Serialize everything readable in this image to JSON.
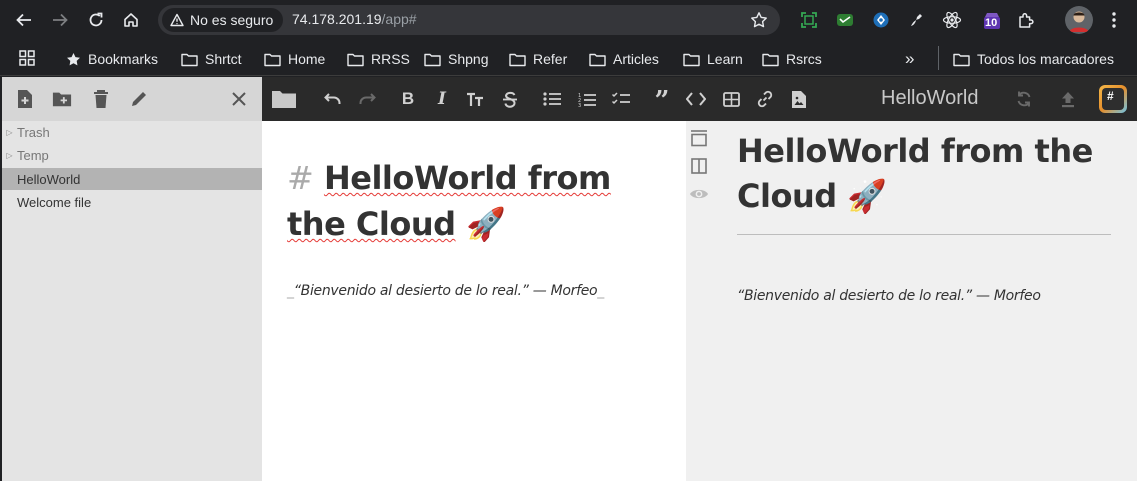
{
  "browser": {
    "security_label": "No es seguro",
    "url_host": "74.178.201.19",
    "url_path": "/app#",
    "extension_badge": "10",
    "bookmarks": [
      {
        "label": "Bookmarks",
        "icon": "star-icon"
      },
      {
        "label": "Shrtct",
        "icon": "folder-icon"
      },
      {
        "label": "Home",
        "icon": "folder-icon"
      },
      {
        "label": "RRSS",
        "icon": "folder-icon"
      },
      {
        "label": "Shpng",
        "icon": "folder-icon"
      },
      {
        "label": "Refer",
        "icon": "folder-icon"
      },
      {
        "label": "Articles",
        "icon": "folder-icon"
      },
      {
        "label": "Learn",
        "icon": "folder-icon"
      },
      {
        "label": "Rsrcs",
        "icon": "folder-icon"
      }
    ],
    "overflow_label": "»",
    "all_bookmarks_label": "Todos los marcadores"
  },
  "sidebar": {
    "items": [
      {
        "label": "Trash",
        "type": "folder"
      },
      {
        "label": "Temp",
        "type": "folder"
      },
      {
        "label": "HelloWorld",
        "type": "file",
        "active": true
      },
      {
        "label": "Welcome file",
        "type": "file"
      }
    ]
  },
  "toolbar": {
    "document_name": "HelloWorld",
    "badge_label": "#"
  },
  "editor": {
    "heading_marker": "#",
    "heading_text": "HelloWorld from the Cloud",
    "heading_emoji": "🚀",
    "quote_marker": "_",
    "quote_text": "“Bienvenido al desierto de lo real.” — Morfeo",
    "quote_marker_end": "_"
  },
  "preview": {
    "heading_text": "HelloWorld from the Cloud",
    "heading_emoji": "🚀",
    "quote_text": "“Bienvenido al desierto de lo real.” — Morfeo"
  },
  "colors": {
    "chrome_bg": "#202124",
    "editor_toolbar_bg": "#2a2a2a",
    "sidebar_bg": "#e4e4e4",
    "active_item_bg": "#b3b3b3",
    "spellcheck": "#e53935"
  }
}
